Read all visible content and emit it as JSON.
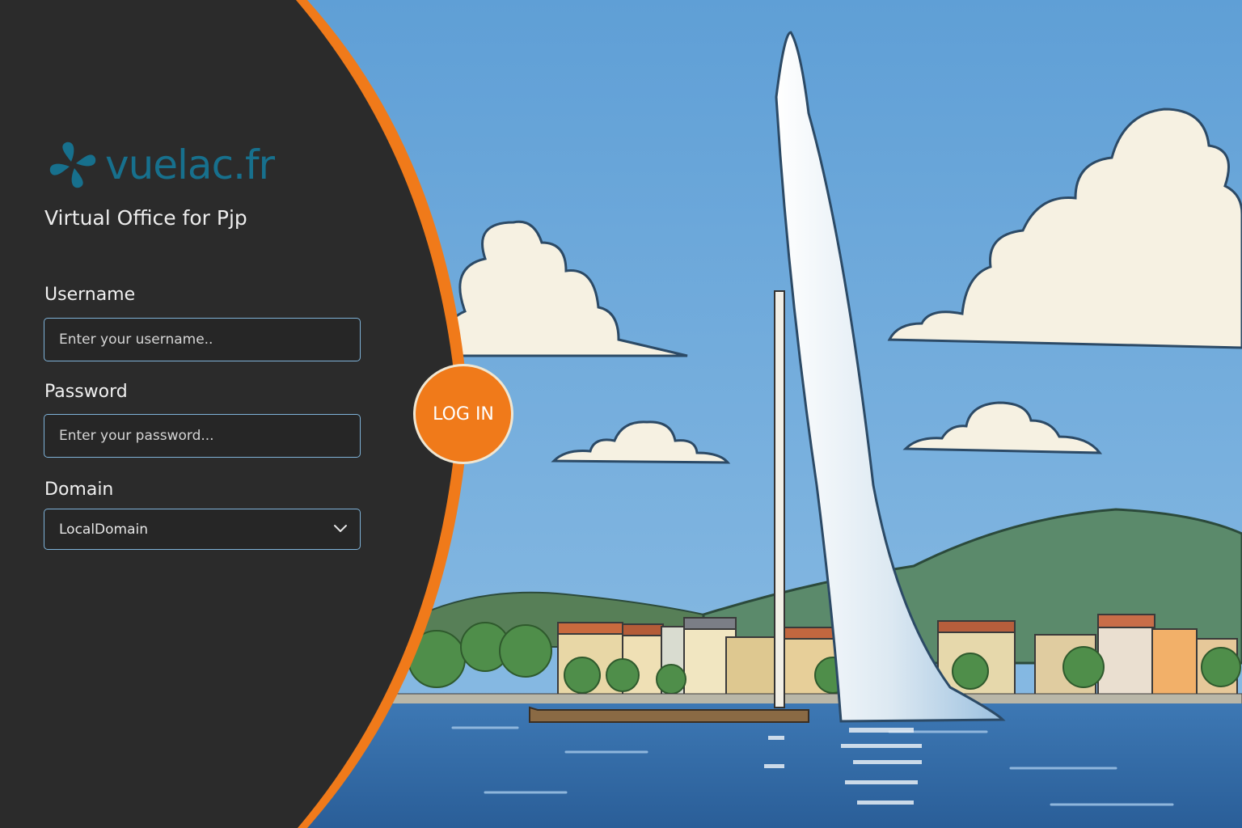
{
  "brand": {
    "name": "vuelac.fr",
    "color": "#17708d",
    "icon": "pinwheel-logo-icon"
  },
  "subtitle": "Virtual Office for Pjp",
  "form": {
    "username": {
      "label": "Username",
      "placeholder": "Enter your username.."
    },
    "password": {
      "label": "Password",
      "placeholder": "Enter your password..."
    },
    "domain": {
      "label": "Domain",
      "value": "LocalDomain"
    },
    "login_label": "LOG IN"
  },
  "colors": {
    "panel": "#2b2b2b",
    "accent": "#f07a1a",
    "field_border": "#7fb3d9",
    "sky": "#6aa6d8",
    "lake": "#2f6aa6"
  },
  "background": {
    "scene": "Jet d'Eau fountain on Lake Geneva illustration"
  }
}
